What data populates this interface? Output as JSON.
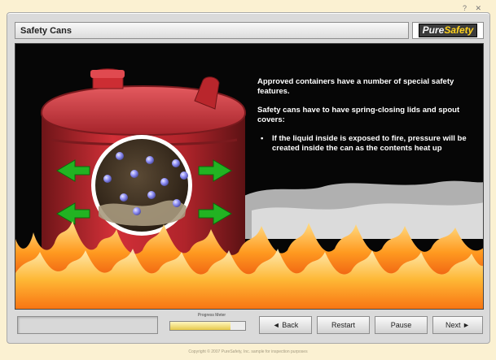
{
  "window": {
    "control_glyphs": "? ✕"
  },
  "header": {
    "title": "Safety Cans",
    "logo_part1": "Pure",
    "logo_part2": "Safety"
  },
  "slide": {
    "intro": "Approved containers have a number of special safety features.",
    "lead": "Safety cans have to have spring-closing lids and spout covers:",
    "bullet_glyph": "•",
    "bullets": [
      "If the liquid inside is exposed to fire, pressure will be created inside the can as the contents heat up"
    ]
  },
  "controls": {
    "progress_label": "Progress Meter",
    "progress_value": 0.8,
    "back_label": "◄ Back",
    "restart_label": "Restart",
    "pause_label": "Pause",
    "next_label": "Next ►"
  },
  "footer": {
    "copyright": "Copyright © 2007 PureSafety, Inc. sample for inspection purposes"
  },
  "colors": {
    "background": "#fbf1d2",
    "logo_accent": "#ffd21f",
    "can_red": "#c8242a",
    "arrow_green": "#22b322",
    "molecule_blue": "#8f8ff5"
  }
}
